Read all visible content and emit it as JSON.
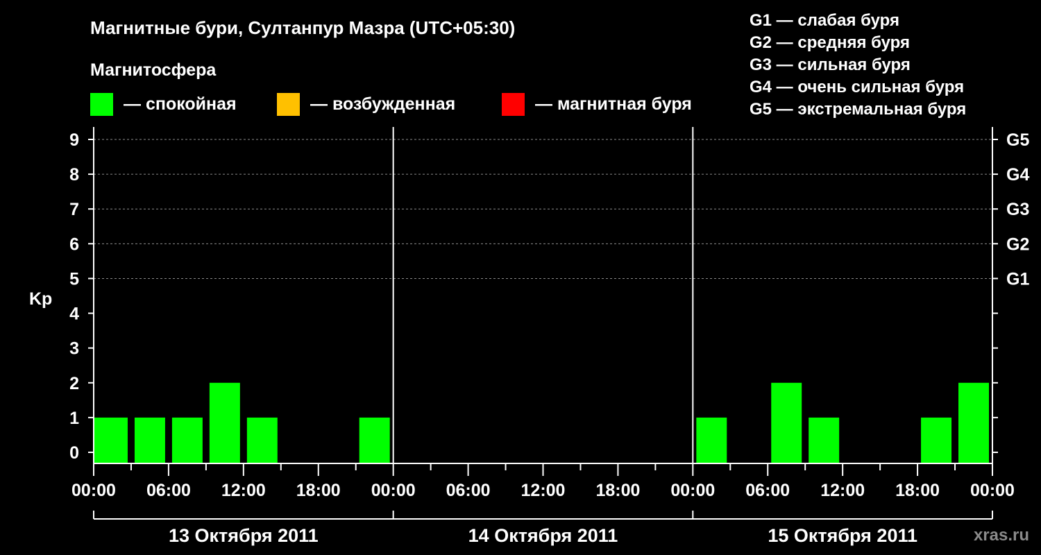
{
  "chart_data": {
    "type": "bar",
    "title": "Магнитные бури, Султанпур Мазра (UTC+05:30)",
    "subtitle": "Магнитосфера",
    "ylabel": "Kp",
    "ylim": [
      0,
      9
    ],
    "yticks": [
      "0",
      "1",
      "2",
      "3",
      "4",
      "5",
      "6",
      "7",
      "8",
      "9"
    ],
    "g_ticks": [
      {
        "kp": 5,
        "label": "G1"
      },
      {
        "kp": 6,
        "label": "G2"
      },
      {
        "kp": 7,
        "label": "G3"
      },
      {
        "kp": 8,
        "label": "G4"
      },
      {
        "kp": 9,
        "label": "G5"
      }
    ],
    "legend": [
      {
        "label": "— спокойная",
        "color": "#00ff00"
      },
      {
        "label": "— возбужденная",
        "color": "#ffc000"
      },
      {
        "label": "— магнитная буря",
        "color": "#ff0000"
      }
    ],
    "g_legend": [
      "G1 — слабая буря",
      "G2 — средняя буря",
      "G3 — сильная буря",
      "G4 — очень сильная буря",
      "G5 — экстремальная буря"
    ],
    "x_tick_labels": [
      "00:00",
      "06:00",
      "12:00",
      "18:00",
      "00:00",
      "06:00",
      "12:00",
      "18:00",
      "00:00",
      "06:00",
      "12:00",
      "18:00",
      "00:00"
    ],
    "days": [
      "13 Октября 2011",
      "14 Октября 2011",
      "15 Октября 2011"
    ],
    "watermark": "xras.ru",
    "bar_color": "#00ff00",
    "grid": true,
    "series": [
      {
        "values": [
          1,
          1,
          1,
          2,
          1,
          0,
          0,
          1,
          0,
          0,
          0,
          0,
          0,
          0,
          0,
          0,
          1,
          0,
          2,
          1,
          0,
          0,
          1,
          2
        ]
      }
    ]
  }
}
